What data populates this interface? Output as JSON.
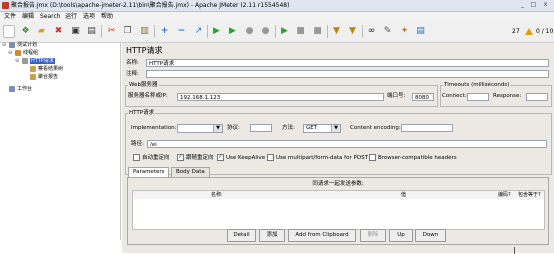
{
  "window": {
    "title": "聚合报告.jmx (D:\\tools\\apache-jmeter-2.11\\bin\\聚合报告.jmx) - Apache JMeter (2.11 r1554548)",
    "controls": [
      "_",
      "□",
      "x"
    ]
  },
  "menu": [
    "文件",
    "编辑",
    "Search",
    "运行",
    "选项",
    "帮助"
  ],
  "toolbar": {
    "warning_count": "27",
    "threads": "0 / 10"
  },
  "tree": {
    "items": [
      {
        "label": "测试计划"
      },
      {
        "label": "线程组"
      },
      {
        "label": "HTTP请求"
      },
      {
        "label": "察看结果树"
      },
      {
        "label": "聚合报告"
      },
      {
        "label": "工作台"
      }
    ]
  },
  "panel": {
    "title": "HTTP请求",
    "name_label": "名称:",
    "name_value": "HTTP请求",
    "comment_label": "注释:",
    "comment_value": "",
    "web_server": {
      "legend": "Web服务器",
      "server_label": "服务器名称或IP:",
      "server_value": "192.168.1.123",
      "port_label": "端口号:",
      "port_value": "8080"
    },
    "timeouts": {
      "legend": "Timeouts (milliseconds)",
      "connect_label": "Connect:",
      "connect_value": "",
      "response_label": "Response:",
      "response_value": ""
    },
    "http_request": {
      "legend": "HTTP请求",
      "impl_label": "Implementation:",
      "impl_value": "",
      "protocol_label": "协议:",
      "protocol_value": "",
      "method_label": "方法:",
      "method_value": "GET",
      "encoding_label": "Content encoding:",
      "encoding_value": "",
      "path_label": "路径:",
      "path_value": "/ei"
    },
    "options": [
      {
        "label": "自动重定向",
        "checked": false
      },
      {
        "label": "跟随重定向",
        "checked": true
      },
      {
        "label": "Use KeepAlive",
        "checked": true
      },
      {
        "label": "Use multipart/form-data for POST",
        "checked": false
      },
      {
        "label": "Browser-compatible headers",
        "checked": false
      }
    ],
    "tabs": [
      {
        "label": "Parameters"
      },
      {
        "label": "Body Data"
      }
    ],
    "params_caption": "同请求一起发送参数:",
    "columns": [
      "名称:",
      "值",
      "编码?",
      "包含等于?"
    ],
    "buttons": {
      "detail": "Detail",
      "add": "添加",
      "add_clipboard": "Add from Clipboard",
      "delete": "删除",
      "up": "Up",
      "down": "Down"
    }
  },
  "colors": {
    "selection": "#3060c8",
    "panel_bg": "#ece9e4",
    "titlebar": "#dfe6f0"
  },
  "icons": [
    "jmeter-icon",
    "new-icon",
    "templates-icon",
    "open-icon",
    "close-icon",
    "save-icon",
    "save-as-icon",
    "cut-icon",
    "copy-icon",
    "paste-icon",
    "expand-icon",
    "collapse-icon",
    "toggle-icon",
    "start-icon",
    "start-no-pause-icon",
    "stop-icon",
    "shutdown-icon",
    "remote-start-icon",
    "remote-stop-icon",
    "remote-shutdown-icon",
    "clear-icon",
    "clear-all-icon",
    "search-icon",
    "reset-search-icon",
    "function-helper-icon",
    "help-icon",
    "warning-icon"
  ]
}
